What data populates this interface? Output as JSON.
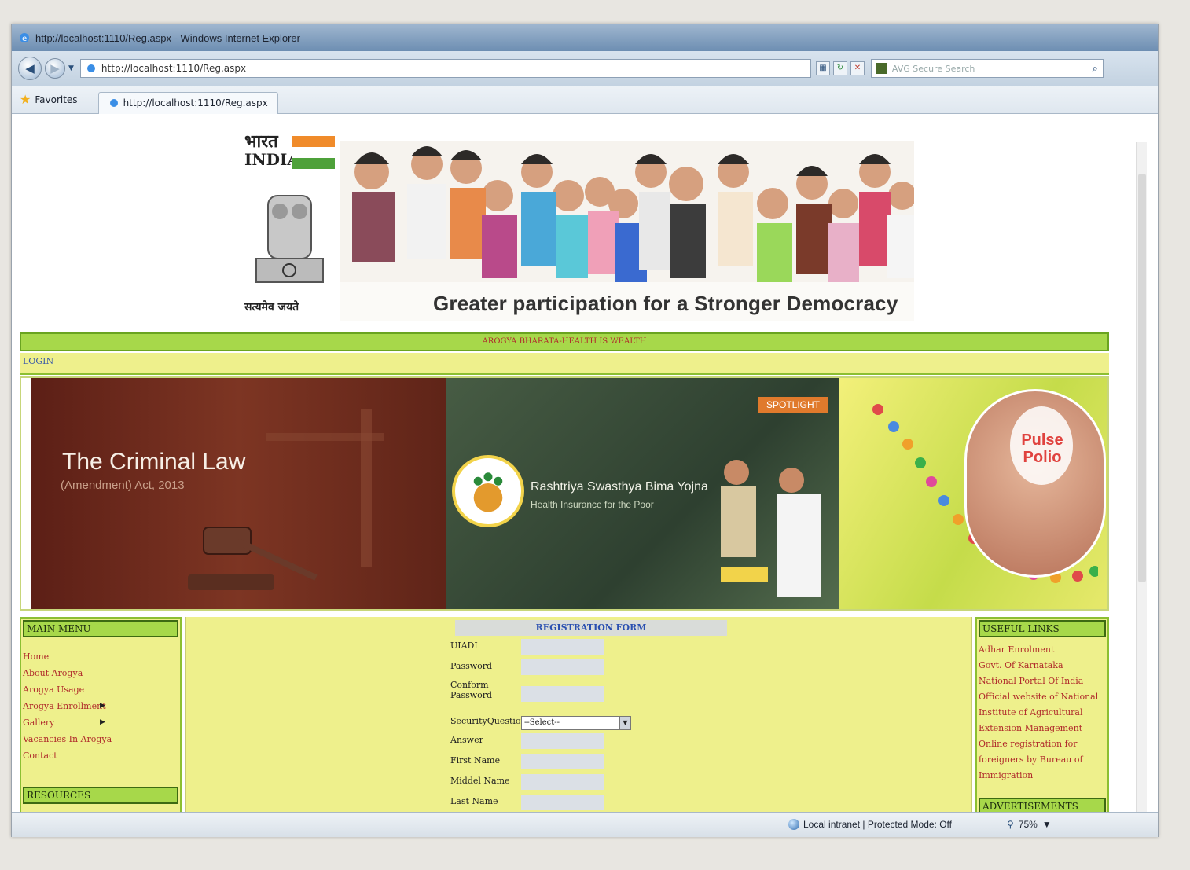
{
  "browser": {
    "window_title": "http://localhost:1110/Reg.aspx - Windows Internet Explorer",
    "address": "http://localhost:1110/Reg.aspx",
    "search_placeholder": "AVG Secure Search",
    "favorites_label": "Favorites",
    "tab_label": "http://localhost:1110/Reg.aspx",
    "status_zone": "Local intranet | Protected Mode: Off",
    "zoom": "75%"
  },
  "header": {
    "logo_hindi": "भारत",
    "logo_english": "INDIA",
    "motto": "सत्यमेव जयते",
    "tagline": "Greater participation for a Stronger Democracy",
    "marquee": "AROGYA BHARATA-HEALTH IS WEALTH"
  },
  "nav": {
    "login": "LOGIN"
  },
  "slides": {
    "law_title": "The Criminal Law",
    "law_subtitle": "(Amendment) Act, 2013",
    "spotlight": "SPOTLIGHT",
    "rsby_title": "Rashtriya Swasthya Bima Yojna",
    "rsby_subtitle": "Health Insurance for the Poor",
    "polio": "Pulse Polio"
  },
  "left_panel": {
    "title": "MAIN MENU",
    "items": [
      "Home",
      "About Arogya",
      "Arogya Usage",
      "Arogya Enrollment",
      "Gallery",
      "Vacancies In Arogya",
      "Contact"
    ],
    "resources_title": "RESOURCES"
  },
  "form": {
    "title": "REGISTRATION FORM",
    "labels": {
      "uid": "UIADI",
      "password": "Password",
      "confirm": "Conform Password",
      "security": "SecurityQuestion",
      "answer": "Answer",
      "first": "First Name",
      "middle": "Middel Name",
      "last": "Last Name"
    },
    "security_value": "--Select--"
  },
  "right_panel": {
    "title": "USEFUL LINKS",
    "links": [
      "Adhar Enrolment",
      "Govt. Of Karnataka",
      "National Portal Of India",
      "Official website of National Institute of Agricultural Extension Management",
      "Online registration for foreigners by Bureau of Immigration"
    ],
    "adv_title": "ADVERTISEMENTS"
  },
  "colors": {
    "panel_yellow": "#eef08c",
    "bar_green": "#a7d84a",
    "link_red": "#b02b2b",
    "form_title_blue": "#2a4fb0"
  }
}
